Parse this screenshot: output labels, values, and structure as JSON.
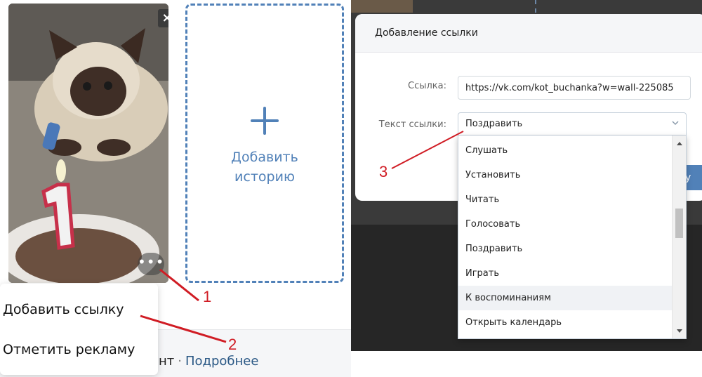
{
  "left_panel": {
    "story_close_icon": "×",
    "story_more_icon": "•••",
    "add_story": {
      "label": "Добавить\nисторию"
    },
    "context_menu": {
      "items": [
        "Добавить ссылку",
        "Отметить рекламу"
      ]
    },
    "footer": {
      "prefix": "нт",
      "separator": "·",
      "more_link": "Подробнее"
    }
  },
  "annotations": {
    "one": "1",
    "two": "2",
    "three": "3"
  },
  "dialog": {
    "title": "Добавление ссылки",
    "link_label": "Ссылка:",
    "link_value": "https://vk.com/kot_buchanka?w=wall-225085",
    "link_text_label": "Текст ссылки:",
    "selected_value": "Поздравить",
    "button_label": "у"
  },
  "dropdown": {
    "options": [
      "Слушать",
      "Установить",
      "Читать",
      "Голосовать",
      "Поздравить",
      "Играть",
      "К воспоминаниям",
      "Открыть календарь"
    ],
    "hovered_index": 6
  },
  "colors": {
    "accent": "#5181b8",
    "annotation_red": "#d01c24",
    "link_blue": "#2a5885"
  }
}
